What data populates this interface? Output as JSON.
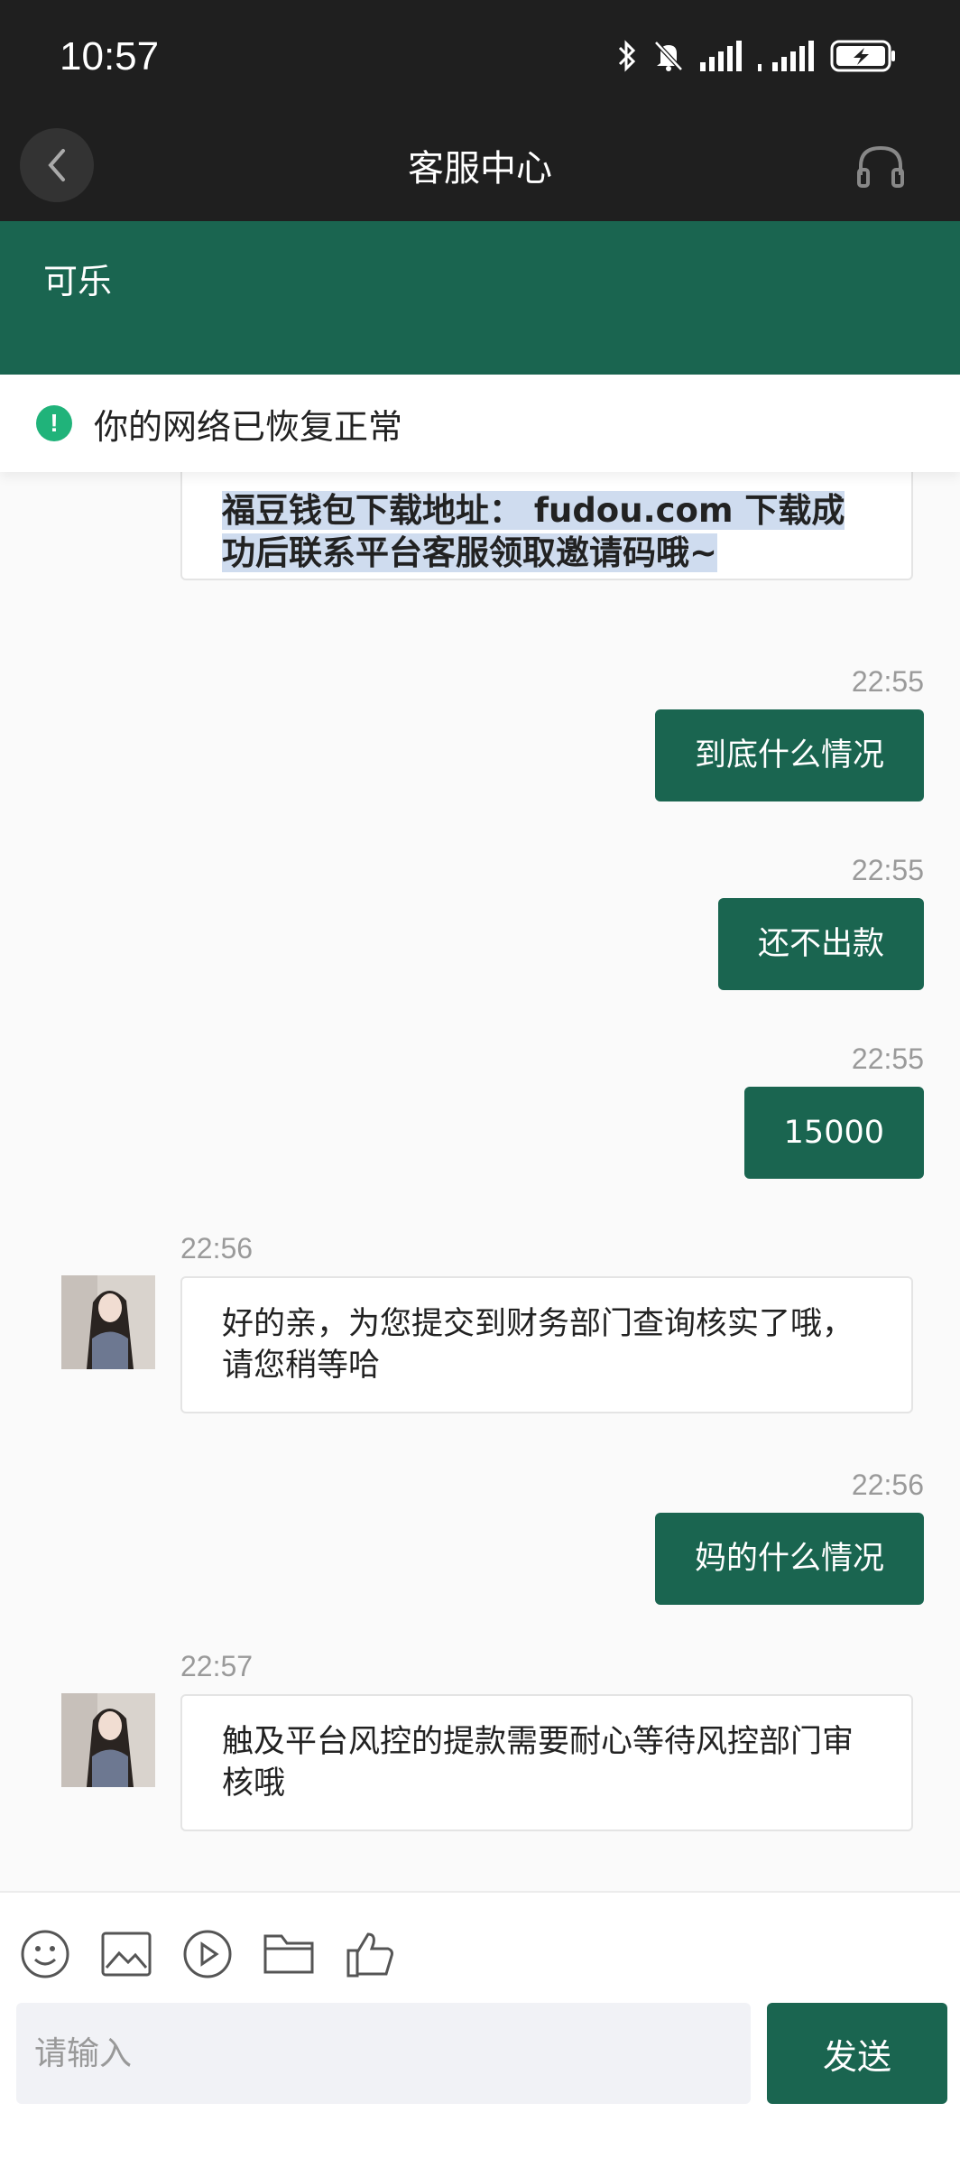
{
  "status_bar": {
    "time": "10:57",
    "icons": [
      "bluetooth-icon",
      "mute-bell-icon",
      "signal-icon",
      "signal-icon",
      "battery-charging-icon"
    ]
  },
  "title_bar": {
    "title": "客服中心",
    "back_icon": "chevron-left-icon",
    "right_icon": "headset-icon"
  },
  "agent": {
    "name": "可乐"
  },
  "network_banner": {
    "icon": "!",
    "text": "你的网络已恢复正常"
  },
  "colors": {
    "primary": "#1a6550",
    "status_bg": "#1f1f1f",
    "ok_green": "#20b37a",
    "highlight": "#cfdcef"
  },
  "messages": [
    {
      "side": "in",
      "text": "福豆钱包下载地址： fudou.com 下载成功后联系平台客服领取邀请码哦~",
      "time": ""
    },
    {
      "side": "out",
      "text": "到底什么情况",
      "time": "22:55"
    },
    {
      "side": "out",
      "text": "还不出款",
      "time": "22:55"
    },
    {
      "side": "out",
      "text": "15000",
      "time": "22:55"
    },
    {
      "side": "in",
      "text": "好的亲，为您提交到财务部门查询核实了哦，请您稍等哈",
      "time": "22:56"
    },
    {
      "side": "out",
      "text": "妈的什么情况",
      "time": "22:56"
    },
    {
      "side": "in",
      "text": "触及平台风控的提款需要耐心等待风控部门审核哦",
      "time": "22:57"
    }
  ],
  "composer": {
    "tools": [
      "emoji-icon",
      "image-icon",
      "video-icon",
      "folder-icon",
      "thumbs-up-icon"
    ],
    "placeholder": "请输入",
    "value": "",
    "send_label": "发送"
  }
}
